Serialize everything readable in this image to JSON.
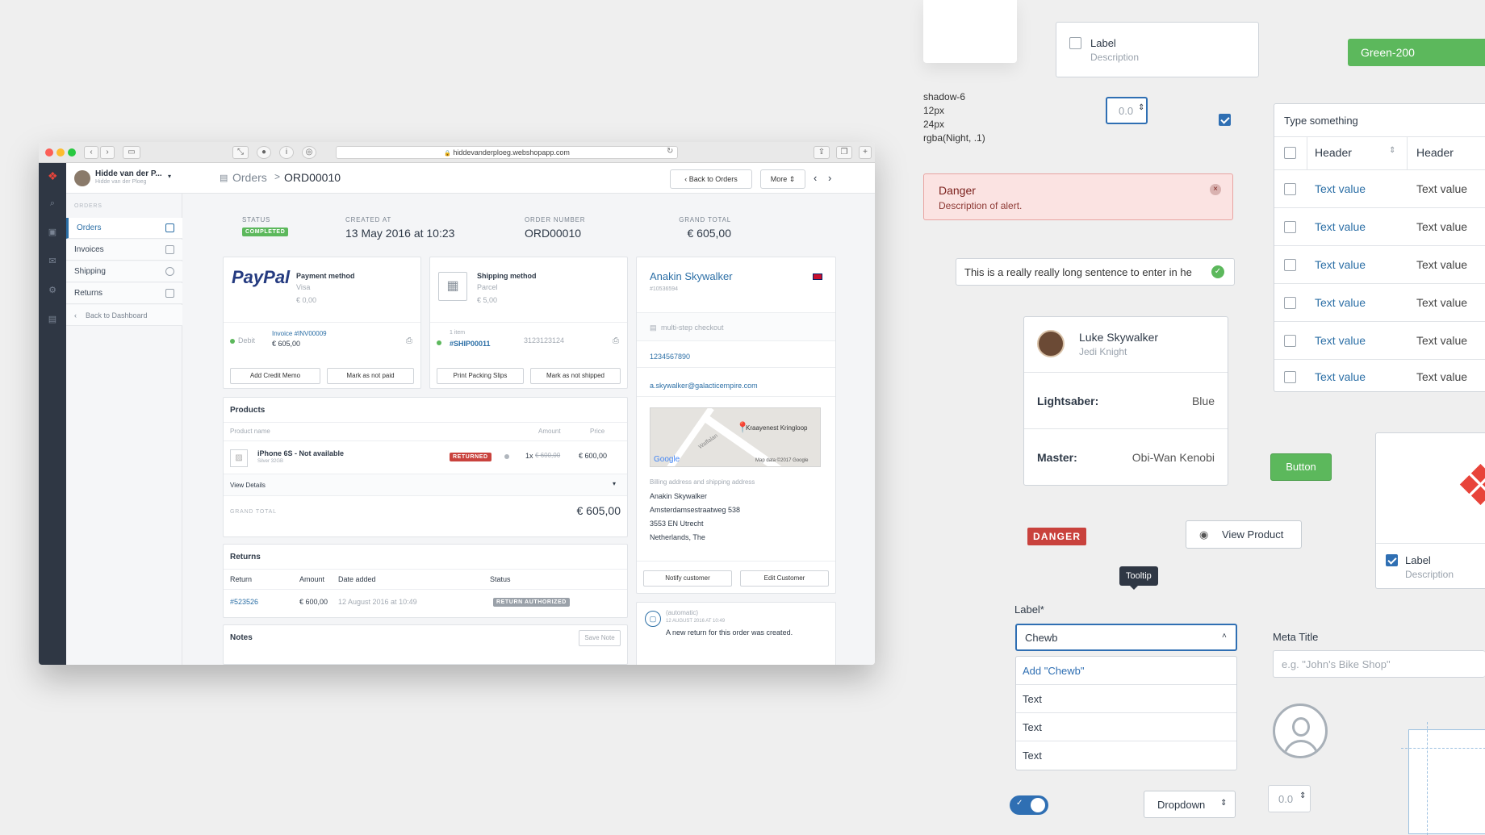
{
  "browser": {
    "url": "hiddevanderploeg.webshopapp.com"
  },
  "sidebar": {
    "user_name": "Hidde van der P...",
    "user_sub": "Hidde van der Ploeg",
    "section": "ORDERS",
    "items": [
      {
        "label": "Orders"
      },
      {
        "label": "Invoices"
      },
      {
        "label": "Shipping"
      },
      {
        "label": "Returns"
      }
    ],
    "back": "Back to Dashboard"
  },
  "topbar": {
    "crumb_parent": "Orders",
    "crumb_sep": ">",
    "crumb_current": "ORD00010",
    "back_orders": "Back to Orders",
    "more": "More"
  },
  "summary": {
    "status_label": "STATUS",
    "status_value": "COMPLETED",
    "created_label": "CREATED AT",
    "created_value": "13 May 2016 at 10:23",
    "number_label": "ORDER NUMBER",
    "number_value": "ORD00010",
    "total_label": "GRAND TOTAL",
    "total_value": "€ 605,00"
  },
  "payment": {
    "logo": "PayPal",
    "title": "Payment method",
    "method": "Visa",
    "amount": "€ 0,00",
    "status": "Debit",
    "invoice": "Invoice #INV00009",
    "invoice_amount": "€ 605,00",
    "btn1": "Add Credit Memo",
    "btn2": "Mark as not paid"
  },
  "shipping": {
    "title": "Shipping method",
    "method": "Parcel",
    "amount": "€ 5,00",
    "items": "1 item",
    "ship_id": "#SHIP00011",
    "tracking": "3123123124",
    "btn1": "Print Packing Slips",
    "btn2": "Mark as not shipped"
  },
  "customer": {
    "name": "Anakin Skywalker",
    "id": "#10536594",
    "checkout": "multi-step checkout",
    "phone": "1234567890",
    "email": "a.skywalker@galacticempire.com",
    "map_label": "Kraayenest Kringloop",
    "map_road": "Waffalan",
    "map_google": "Google",
    "map_credit": "Map data ©2017 Google",
    "addr_label": "Billing address and shipping address",
    "addr": [
      "Anakin Skywalker",
      "Amsterdamsestraatweg 538",
      "3553 EN Utrecht",
      "Netherlands, The"
    ],
    "btn1": "Notify customer",
    "btn2": "Edit Customer"
  },
  "products": {
    "title": "Products",
    "cols": [
      "Product name",
      "Amount",
      "Price"
    ],
    "name": "iPhone 6S - Not available",
    "variant": "Silver 32GB",
    "badge": "RETURNED",
    "qty": "1x",
    "old_price": "€ 600,00",
    "price": "€ 600,00",
    "details": "View Details",
    "total_label": "GRAND TOTAL",
    "total": "€ 605,00"
  },
  "returns": {
    "title": "Returns",
    "cols": [
      "Return",
      "Amount",
      "Date added",
      "Status"
    ],
    "id": "#523526",
    "amount": "€ 600,00",
    "date": "12 August 2016 at 10:49",
    "status": "RETURN AUTHORIZED"
  },
  "notes": {
    "title": "Notes",
    "save": "Save Note"
  },
  "activity": {
    "who": "(automatic)",
    "when": "12 AUGUST 2016 AT 10:49",
    "text": "A new return for this order was created."
  },
  "components": {
    "shadow": [
      "shadow-6",
      "12px",
      "24px",
      "rgba(Night, .1)"
    ],
    "checkbox1": {
      "label": "Label",
      "desc": "Description"
    },
    "green_pill": "Green-200",
    "stepper1": "0.0",
    "alert": {
      "title": "Danger",
      "desc": "Description of alert."
    },
    "long_input": "This is a really really long sentence to enter in he",
    "profile": {
      "name": "Luke Skywalker",
      "role": "Jedi Knight",
      "row1_k": "Lightsaber:",
      "row1_v": "Blue",
      "row2_k": "Master:",
      "row2_v": "Obi-Wan Kenobi"
    },
    "table": {
      "title": "Type something",
      "headers": [
        "Header",
        "Header"
      ],
      "rows": [
        [
          "Text value",
          "Text value"
        ],
        [
          "Text value",
          "Text value"
        ],
        [
          "Text value",
          "Text value"
        ],
        [
          "Text value",
          "Text value"
        ],
        [
          "Text value",
          "Text value"
        ],
        [
          "Text value",
          "Text value"
        ]
      ]
    },
    "button": "Button",
    "danger_badge": "DANGER",
    "view_product": "View Product",
    "tooltip": "Tooltip",
    "checkbox2": {
      "label": "Label",
      "desc": "Description"
    },
    "select": {
      "label": "Label*",
      "value": "Chewb",
      "options": [
        "Add \"Chewb\"",
        "Text",
        "Text",
        "Text"
      ]
    },
    "meta": {
      "label": "Meta Title",
      "placeholder": "e.g. \"John's Bike Shop\""
    },
    "dropdown": "Dropdown",
    "stepper2": "0.0"
  },
  "colors": {
    "brand": "#e8443a",
    "primary": "#2f6fb3",
    "success": "#5cb85c",
    "danger": "#c9423d",
    "rail": "#2f3744"
  }
}
